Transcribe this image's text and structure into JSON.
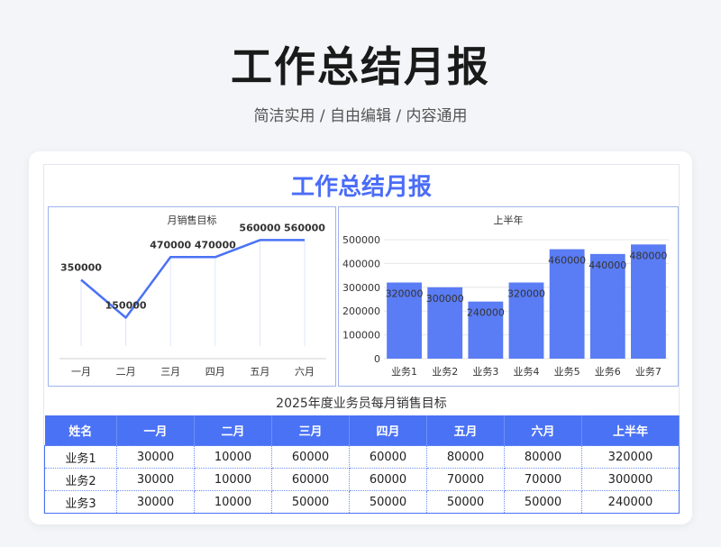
{
  "page": {
    "title": "工作总结月报",
    "subtitle": "简洁实用 / 自由编辑 / 内容通用"
  },
  "sheet": {
    "title": "工作总结月报"
  },
  "colors": {
    "accent": "#4a72f5",
    "bar": "#5a7cf4",
    "line": "#4a72f5",
    "title": "#4a6cf7"
  },
  "chart_data": [
    {
      "type": "line",
      "title": "月销售目标",
      "categories": [
        "一月",
        "二月",
        "三月",
        "四月",
        "五月",
        "六月"
      ],
      "series": [
        {
          "values": [
            350000,
            150000,
            470000,
            470000,
            560000,
            560000
          ]
        }
      ],
      "data_labels": [
        "350000",
        "150000",
        "470000",
        "470000",
        "560000",
        "560000"
      ],
      "ylim": [
        0,
        600000
      ],
      "grid": false,
      "legend": "none"
    },
    {
      "type": "bar",
      "title": "上半年",
      "categories": [
        "业务1",
        "业务2",
        "业务3",
        "业务4",
        "业务5",
        "业务6",
        "业务7"
      ],
      "values": [
        320000,
        300000,
        240000,
        320000,
        460000,
        440000,
        480000
      ],
      "data_labels": [
        "320000",
        "300000",
        "240000",
        "320000",
        "460000",
        "440000",
        "480000"
      ],
      "ylim": [
        0,
        500000
      ],
      "yticks": [
        "0",
        "100000",
        "200000",
        "300000",
        "400000",
        "500000"
      ],
      "grid": true,
      "legend": "none"
    }
  ],
  "table": {
    "caption": "2025年度业务员每月销售目标",
    "headers": [
      "姓名",
      "一月",
      "二月",
      "三月",
      "四月",
      "五月",
      "六月",
      "上半年"
    ],
    "rows": [
      [
        "业务1",
        "30000",
        "10000",
        "60000",
        "60000",
        "80000",
        "80000",
        "320000"
      ],
      [
        "业务2",
        "30000",
        "10000",
        "60000",
        "60000",
        "70000",
        "70000",
        "300000"
      ],
      [
        "业务3",
        "30000",
        "10000",
        "50000",
        "50000",
        "50000",
        "50000",
        "240000"
      ]
    ]
  }
}
